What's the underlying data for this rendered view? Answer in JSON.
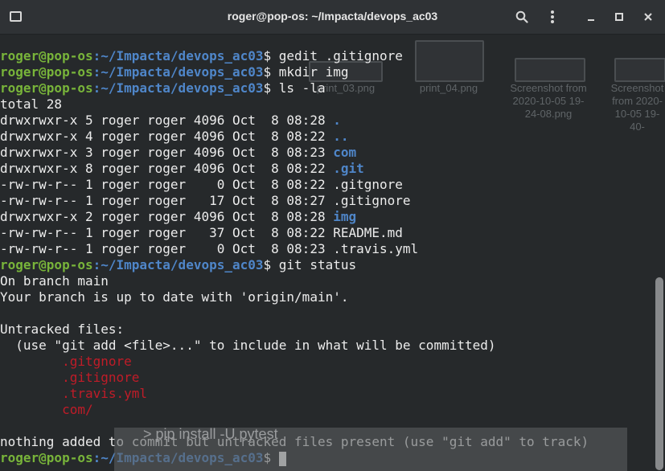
{
  "window": {
    "title": "roger@pop-os: ~/Impacta/devops_ac03"
  },
  "icons": {
    "new_tab": "new-tab-icon",
    "search": "search-icon",
    "menu": "menu-dots-icon",
    "minimize": "minimize-icon",
    "maximize": "maximize-icon",
    "close": "close-icon"
  },
  "colors": {
    "background": "#26292b",
    "prompt_user": "#78b43a",
    "prompt_path": "#4f86c9",
    "directory": "#4f86c9",
    "untracked": "#c01c28",
    "text": "#ececec"
  },
  "background_desktop": {
    "files": [
      {
        "label": "print_03.png"
      },
      {
        "label": "print_04.png"
      },
      {
        "label": "Screenshot from 2020-10-05 19-24-08.png"
      },
      {
        "label": "Screenshot from 2020-10-05 19-40-"
      }
    ],
    "overlay_text": "> pip install -U pytest"
  },
  "prompt": {
    "user": "roger@pop-os",
    "path": ":~/Impacta/devops_ac03",
    "symbol": "$ "
  },
  "terminal": {
    "commands": [
      "gedit .gitignore",
      "mkdir img",
      "ls -la",
      "git status"
    ],
    "ls_total": "total 28",
    "ls_entries": [
      {
        "meta": "drwxrwxr-x 5 roger roger 4096 Oct  8 08:28 ",
        "name": "."
      },
      {
        "meta": "drwxrwxr-x 4 roger roger 4096 Oct  8 08:22 ",
        "name": ".."
      },
      {
        "meta": "drwxrwxr-x 3 roger roger 4096 Oct  8 08:23 ",
        "name": "com"
      },
      {
        "meta": "drwxrwxr-x 8 roger roger 4096 Oct  8 08:22 ",
        "name": ".git"
      },
      {
        "meta": "-rw-rw-r-- 1 roger roger    0 Oct  8 08:22 ",
        "name": ".gitgnore"
      },
      {
        "meta": "-rw-rw-r-- 1 roger roger   17 Oct  8 08:27 ",
        "name": ".gitignore"
      },
      {
        "meta": "drwxrwxr-x 2 roger roger 4096 Oct  8 08:28 ",
        "name": "img"
      },
      {
        "meta": "-rw-rw-r-- 1 roger roger   37 Oct  8 08:22 ",
        "name": "README.md"
      },
      {
        "meta": "-rw-rw-r-- 1 roger roger    0 Oct  8 08:23 ",
        "name": ".travis.yml"
      }
    ],
    "status": {
      "branch": "On branch main",
      "uptodate": "Your branch is up to date with 'origin/main'.",
      "untracked_header": "Untracked files:",
      "hint": "  (use \"git add <file>...\" to include in what will be committed)",
      "files": [
        "        .gitgnore",
        "        .gitignore",
        "        .travis.yml",
        "        com/"
      ],
      "summary": "nothing added to commit but untracked files present (use \"git add\" to track)"
    }
  }
}
